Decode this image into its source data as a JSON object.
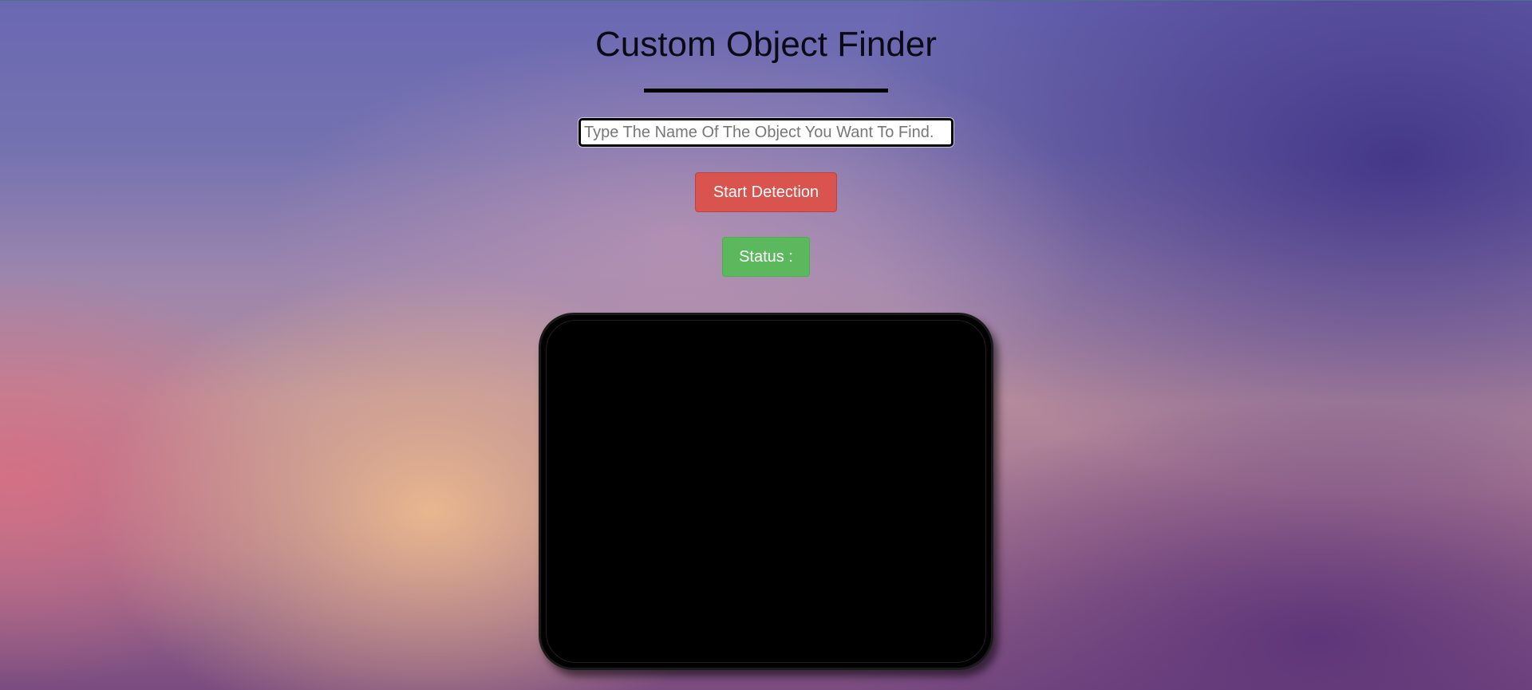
{
  "header": {
    "title": "Custom Object Finder"
  },
  "search": {
    "placeholder": "Type The Name Of The Object You Want To Find.",
    "value": ""
  },
  "actions": {
    "start_label": "Start Detection",
    "start_color": "#d9534f"
  },
  "status": {
    "label": "Status :",
    "color": "#5cb85c"
  },
  "video": {
    "state": "blank"
  }
}
